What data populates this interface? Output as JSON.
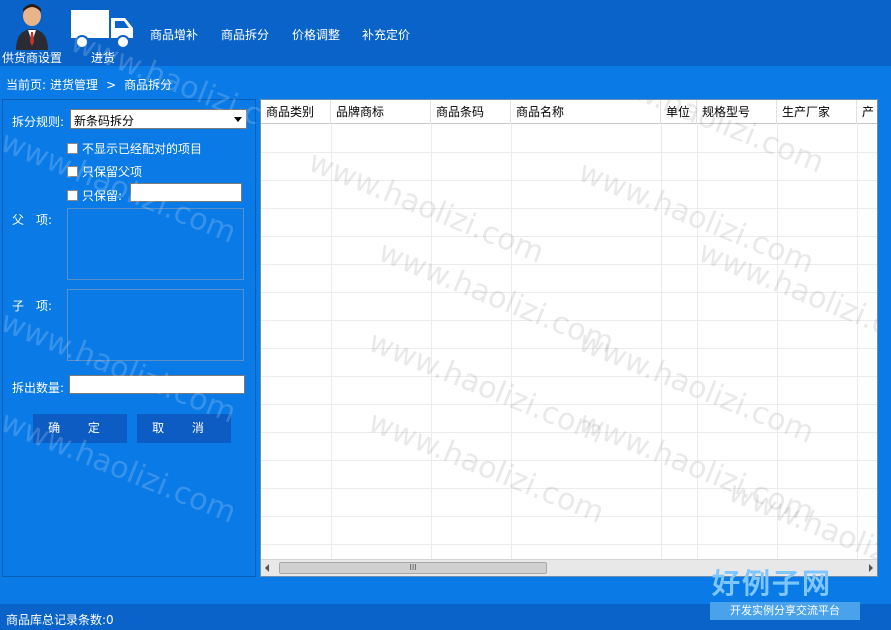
{
  "toolbar": {
    "supplier_label": "供货商设置",
    "stock_label": "进货",
    "menu": [
      "商品增补",
      "商品拆分",
      "价格调整",
      "补充定价"
    ]
  },
  "breadcrumb": {
    "prefix": "当前页:",
    "section": "进货管理",
    "separator": ">",
    "page": "商品拆分"
  },
  "form": {
    "split_rule_label": "拆分规则:",
    "split_rule_value": "新条码拆分",
    "check_hide_matched": "不显示已经配对的项目",
    "check_keep_parent": "只保留父项",
    "check_keep_only": "只保留:",
    "parent_label": "父　项:",
    "child_label": "子　项:",
    "qty_label": "拆出数量:",
    "ok_button": "确 定",
    "cancel_button": "取 消"
  },
  "grid": {
    "columns": [
      "商品类别",
      "品牌商标",
      "商品条码",
      "商品名称",
      "单位",
      "规格型号",
      "生产厂家",
      "产"
    ],
    "scroll_thumb_glyph": "III"
  },
  "status": {
    "text": "商品库总记录条数:0"
  },
  "watermark": {
    "text": "www.haolizi.com"
  },
  "logo": {
    "main": "好例子网",
    "sub": "开发实例分享交流平台"
  },
  "colors": {
    "topbar": "#0a63c9",
    "body": "#0a7ae6",
    "button": "#0c5cc4"
  }
}
